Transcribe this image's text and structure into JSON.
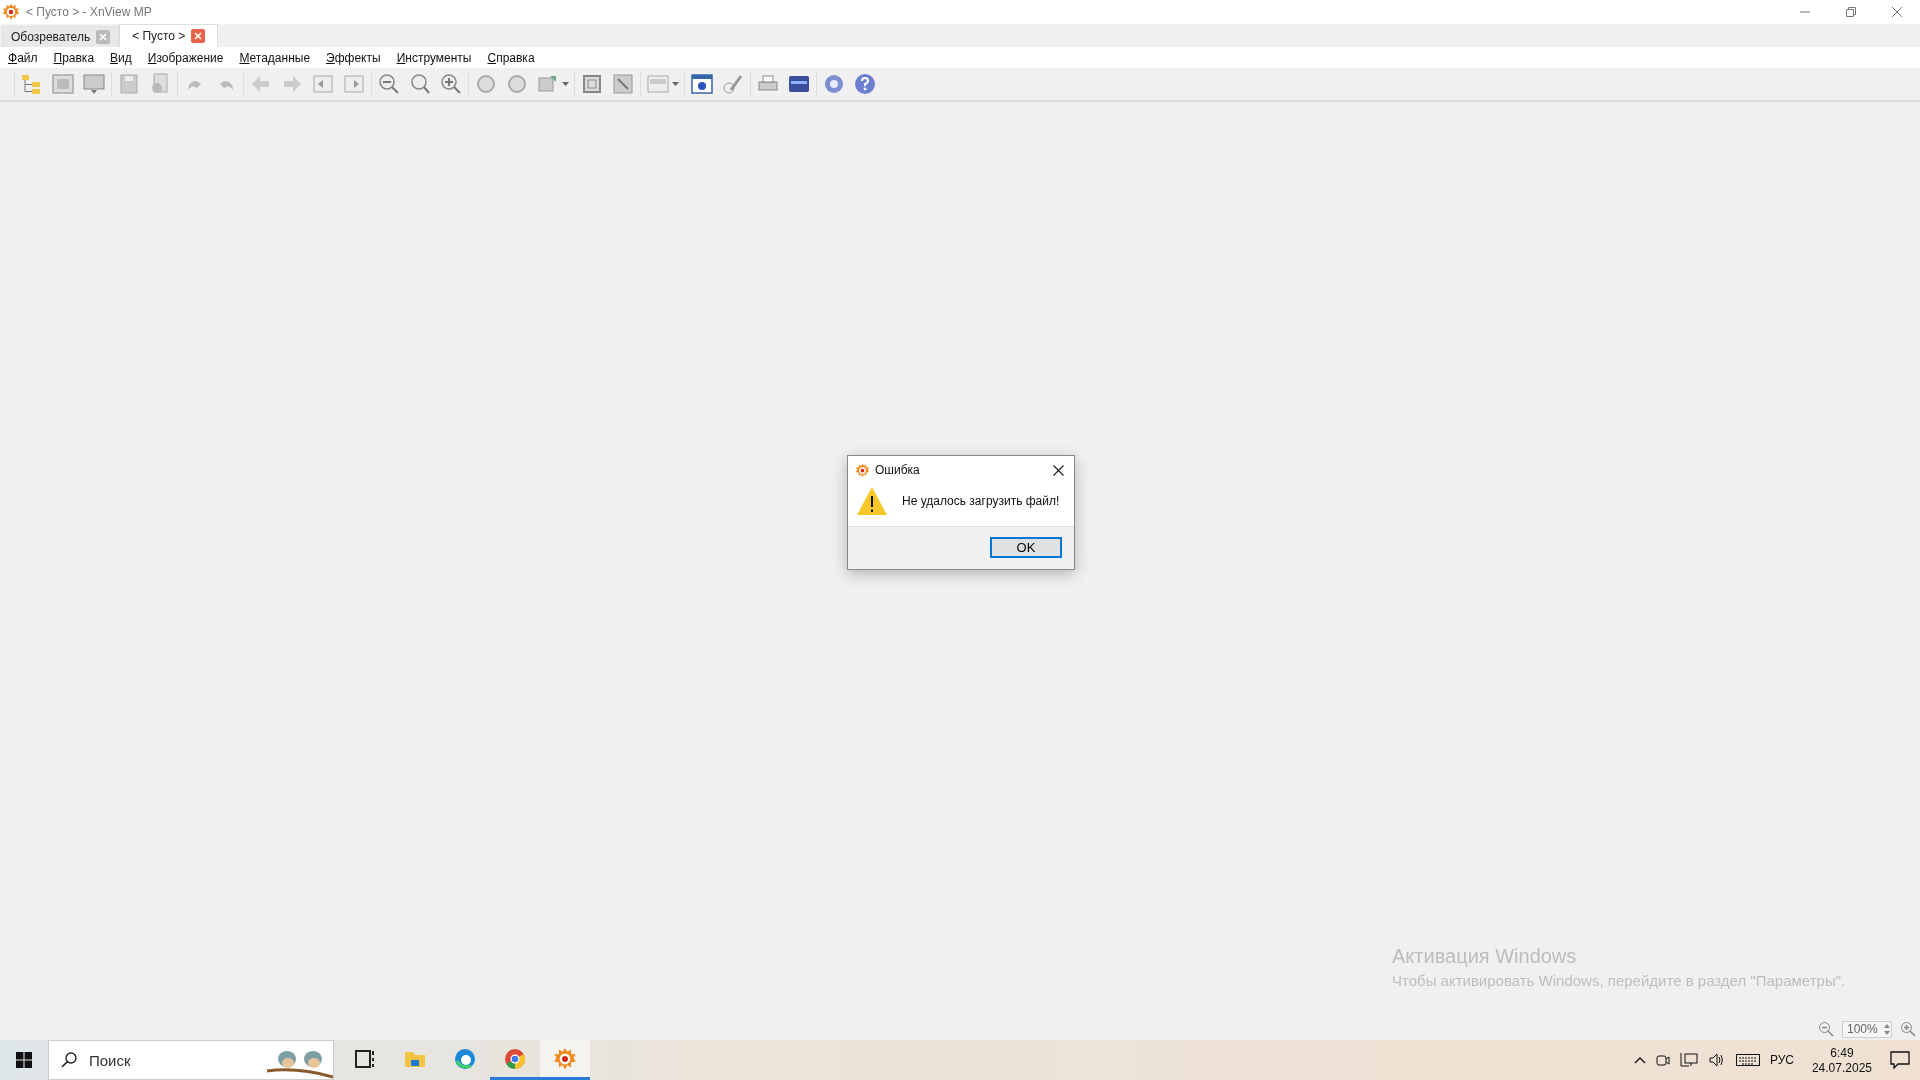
{
  "window": {
    "title": "< Пусто > - XnView MP"
  },
  "tabs": [
    {
      "label": "Обозреватель",
      "selected": false
    },
    {
      "label": "< Пусто >",
      "selected": true
    }
  ],
  "menu": [
    "Файл",
    "Правка",
    "Вид",
    "Изображение",
    "Метаданные",
    "Эффекты",
    "Инструменты",
    "Справка"
  ],
  "dialog": {
    "title": "Ошибка",
    "message": "Не удалось загрузить файл!",
    "buttons": [
      {
        "label": "OK",
        "selected": true
      }
    ]
  },
  "activation_notice": {
    "title": "Активация Windows",
    "text": "Чтобы активировать Windows, перейдите в раздел \"Параметры\"."
  },
  "status_bar": {
    "zoom": "100%"
  },
  "taskbar": {
    "search": {
      "placeholder": "Поиск"
    },
    "apps": [
      {
        "kind": "taskview",
        "running": false,
        "selected": false
      },
      {
        "kind": "folder",
        "running": false,
        "selected": false
      },
      {
        "kind": "edge",
        "running": false,
        "selected": false
      },
      {
        "kind": "chrome",
        "running": true,
        "selected": false
      },
      {
        "kind": "xnview",
        "running": true,
        "selected": true
      }
    ],
    "language": "РУС",
    "time": "6:49",
    "date": "24.07.2025"
  }
}
